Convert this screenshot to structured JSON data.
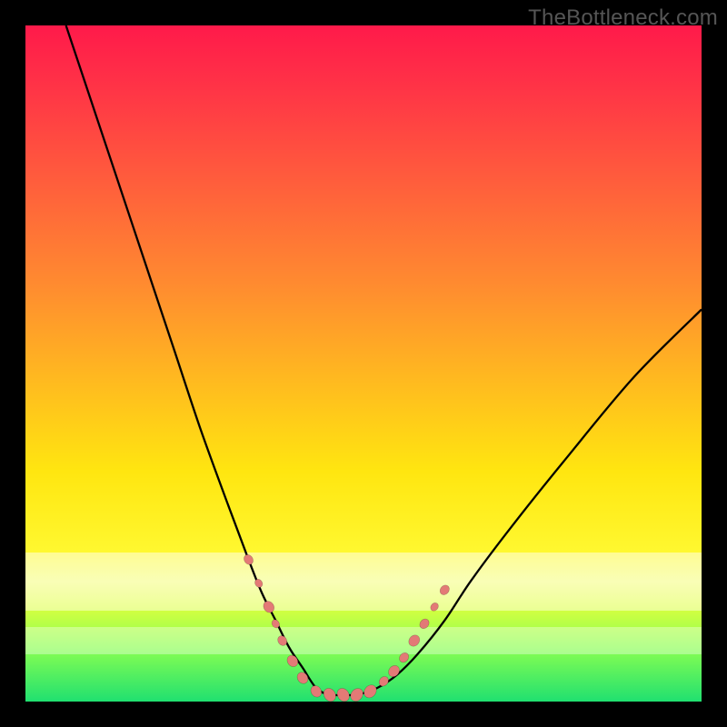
{
  "watermark": "TheBottleneck.com",
  "chart_data": {
    "type": "line",
    "title": "",
    "xlabel": "",
    "ylabel": "",
    "xlim": [
      0,
      100
    ],
    "ylim": [
      0,
      100
    ],
    "series": [
      {
        "name": "bottleneck-curve",
        "x": [
          6,
          10,
          14,
          18,
          22,
          26,
          30,
          33,
          35,
          37,
          39,
          41,
          43,
          45,
          47,
          49,
          52,
          55,
          58,
          62,
          66,
          72,
          80,
          90,
          100
        ],
        "y": [
          100,
          88,
          76,
          64,
          52,
          40,
          29,
          21,
          16,
          12,
          8,
          5,
          2,
          1,
          1,
          1,
          2,
          4,
          7,
          12,
          18,
          26,
          36,
          48,
          58
        ]
      }
    ],
    "markers": {
      "name": "highlighted-points",
      "color": "#e37a76",
      "points": [
        {
          "x": 33,
          "y": 21,
          "r": 6
        },
        {
          "x": 34.5,
          "y": 17.5,
          "r": 5
        },
        {
          "x": 36,
          "y": 14,
          "r": 7
        },
        {
          "x": 37,
          "y": 11.5,
          "r": 5
        },
        {
          "x": 38,
          "y": 9,
          "r": 6
        },
        {
          "x": 39.5,
          "y": 6,
          "r": 7
        },
        {
          "x": 41,
          "y": 3.5,
          "r": 7
        },
        {
          "x": 43,
          "y": 1.5,
          "r": 7
        },
        {
          "x": 45,
          "y": 1,
          "r": 8
        },
        {
          "x": 47,
          "y": 1,
          "r": 8
        },
        {
          "x": 49,
          "y": 1,
          "r": 8
        },
        {
          "x": 51,
          "y": 1.5,
          "r": 8
        },
        {
          "x": 53,
          "y": 3,
          "r": 6
        },
        {
          "x": 54.5,
          "y": 4.5,
          "r": 7
        },
        {
          "x": 56,
          "y": 6.5,
          "r": 6
        },
        {
          "x": 57.5,
          "y": 9,
          "r": 7
        },
        {
          "x": 59,
          "y": 11.5,
          "r": 6
        },
        {
          "x": 60.5,
          "y": 14,
          "r": 5
        },
        {
          "x": 62,
          "y": 16.5,
          "r": 6
        }
      ]
    },
    "background": {
      "type": "vertical-gradient",
      "stops": [
        {
          "pos": 0.0,
          "color": "#ff1a4a"
        },
        {
          "pos": 0.4,
          "color": "#ff9a2a"
        },
        {
          "pos": 0.7,
          "color": "#ffe610"
        },
        {
          "pos": 1.0,
          "color": "#20e070"
        }
      ]
    }
  }
}
